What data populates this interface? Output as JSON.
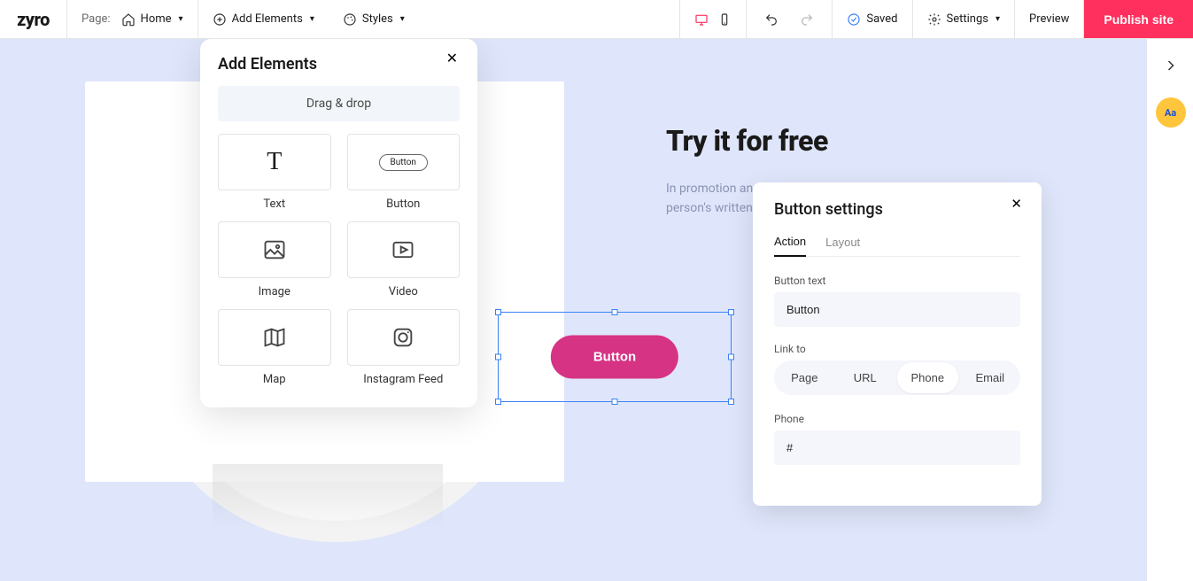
{
  "topbar": {
    "logo": "zyro",
    "page_label": "Page:",
    "page_name": "Home",
    "add_elements": "Add Elements",
    "styles": "Styles",
    "saved": "Saved",
    "settings": "Settings",
    "preview": "Preview",
    "publish": "Publish site"
  },
  "canvas": {
    "hero_title": "Try it for free",
    "hero_desc": "In promotion and of advertising, a testimonial or show consists of a person's written or spoken",
    "selected_button_text": "Button"
  },
  "add_panel": {
    "title": "Add Elements",
    "drag_label": "Drag & drop",
    "items": [
      {
        "label": "Text"
      },
      {
        "label": "Button",
        "chip": "Button"
      },
      {
        "label": "Image"
      },
      {
        "label": "Video"
      },
      {
        "label": "Map"
      },
      {
        "label": "Instagram Feed"
      }
    ]
  },
  "button_settings": {
    "title": "Button settings",
    "tabs": {
      "action": "Action",
      "layout": "Layout"
    },
    "button_text_label": "Button text",
    "button_text_value": "Button",
    "link_to_label": "Link to",
    "link_options": {
      "page": "Page",
      "url": "URL",
      "phone": "Phone",
      "email": "Email"
    },
    "link_selected": "Phone",
    "phone_label": "Phone",
    "phone_value": "#"
  },
  "rail": {
    "aa": "Aa"
  }
}
